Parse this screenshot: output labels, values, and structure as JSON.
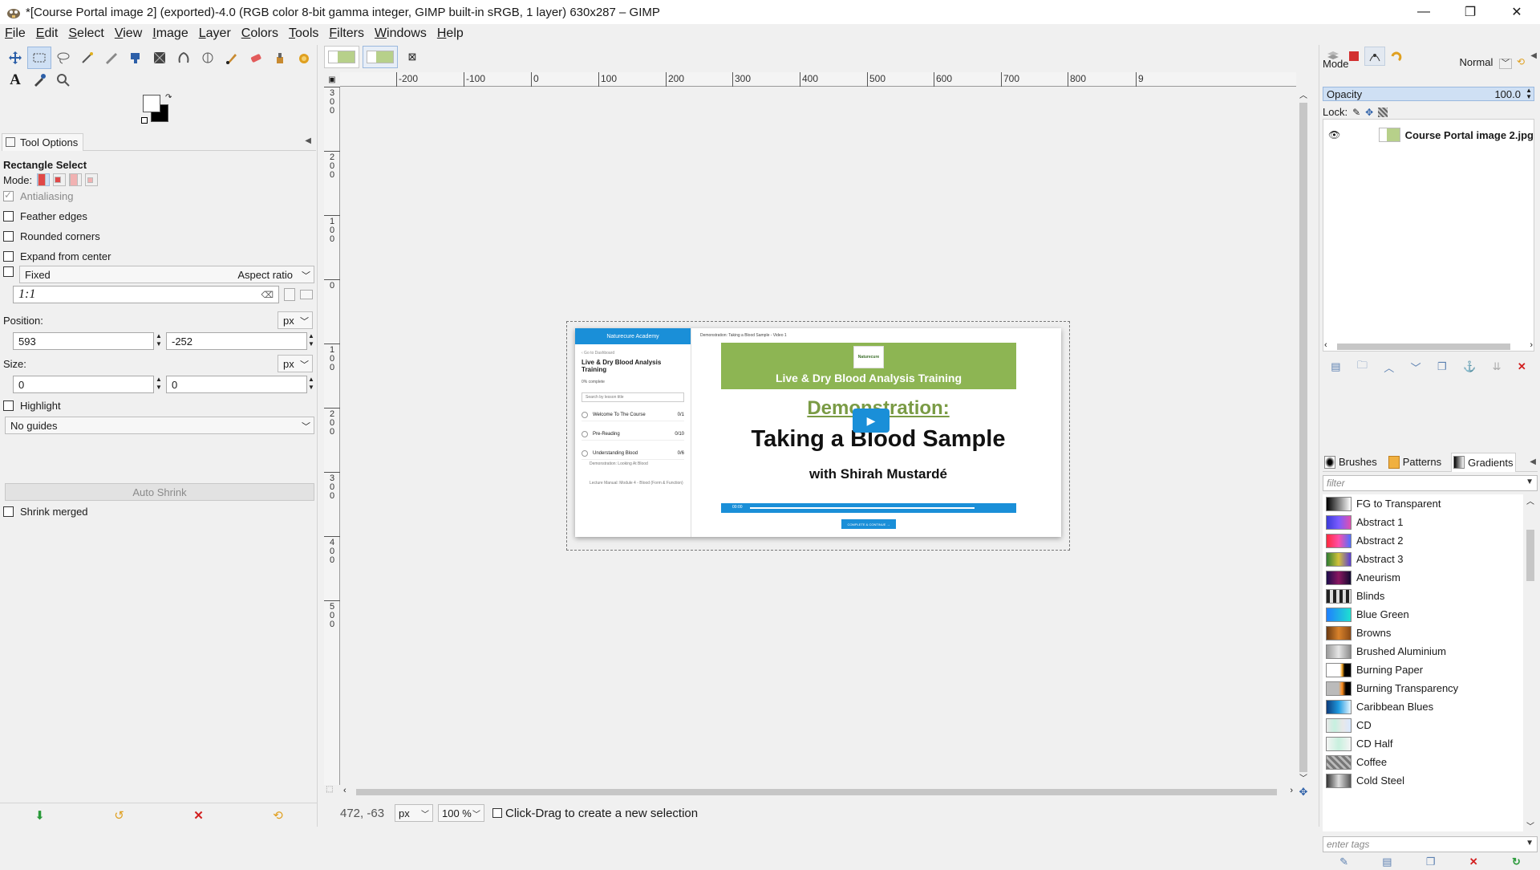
{
  "window": {
    "title": "*[Course Portal image 2] (exported)-4.0 (RGB color 8-bit gamma integer, GIMP built-in sRGB, 1 layer) 630x287 – GIMP",
    "minimize": "—",
    "maximize": "❐",
    "close": "✕"
  },
  "menu": [
    "File",
    "Edit",
    "Select",
    "View",
    "Image",
    "Layer",
    "Colors",
    "Tools",
    "Filters",
    "Windows",
    "Help"
  ],
  "toolbox": {
    "row1": [
      "move-tool-icon",
      "rect-select-icon",
      "lasso-icon",
      "fuzzy-select-icon",
      "paths-icon",
      "crop-icon",
      "transform-icon",
      "warp-icon",
      "perspective-icon",
      "paintbrush-icon",
      "eraser-icon",
      "clone-icon",
      "smudge-icon",
      "scissors-icon"
    ],
    "row2": [
      "text-tool-icon",
      "color-picker-icon",
      "zoom-icon"
    ]
  },
  "tool_options": {
    "tab_label": "Tool Options",
    "tool_name": "Rectangle Select",
    "mode_label": "Mode:",
    "antialiasing": "Antialiasing",
    "feather_edges": "Feather edges",
    "rounded_corners": "Rounded corners",
    "expand_from_center": "Expand from center",
    "fixed_label": "Fixed",
    "fixed_mode": "Aspect ratio",
    "ratio_value": "1:1",
    "position_label": "Position:",
    "position_unit": "px",
    "position_x": "593",
    "position_y": "-252",
    "size_label": "Size:",
    "size_unit": "px",
    "size_w": "0",
    "size_h": "0",
    "highlight": "Highlight",
    "guides": "No guides",
    "auto_shrink": "Auto Shrink",
    "shrink_merged": "Shrink merged"
  },
  "ruler": {
    "h_labels": [
      {
        "text": "-200",
        "pos": 0.0588
      },
      {
        "text": "-100",
        "pos": 0.1289
      },
      {
        "text": "0",
        "pos": 0.1999
      },
      {
        "text": "100",
        "pos": 0.2701
      },
      {
        "text": "200",
        "pos": 0.3402
      },
      {
        "text": "300",
        "pos": 0.4104
      },
      {
        "text": "400",
        "pos": 0.4808
      },
      {
        "text": "500",
        "pos": 0.5508
      },
      {
        "text": "600",
        "pos": 0.6207
      },
      {
        "text": "700",
        "pos": 0.691
      },
      {
        "text": "800",
        "pos": 0.7612
      },
      {
        "text": "9",
        "pos": 0.832
      }
    ],
    "v_labels": [
      {
        "text": "300",
        "pos": 0.0
      },
      {
        "text": "200",
        "pos": 0.092
      },
      {
        "text": "100",
        "pos": 0.184
      },
      {
        "text": "0",
        "pos": 0.276
      },
      {
        "text": "100",
        "pos": 0.368
      },
      {
        "text": "200",
        "pos": 0.46
      },
      {
        "text": "300",
        "pos": 0.552
      },
      {
        "text": "400",
        "pos": 0.644
      },
      {
        "text": "500",
        "pos": 0.736
      }
    ]
  },
  "canvas_image": {
    "brand": "Naturecure Academy",
    "back_link": "‹ Go to Dashboard",
    "course_title": "Live & Dry Blood Analysis Training",
    "progress": "0% complete",
    "search_placeholder": "Search by lesson title",
    "lessons": [
      {
        "title": "Welcome To The Course",
        "count": "0/1"
      },
      {
        "title": "Pre-Reading",
        "count": "0/10"
      },
      {
        "title": "Understanding Blood",
        "count": "0/6"
      }
    ],
    "sublessons": [
      "Demonstration: Looking At Blood",
      "Lecture Manual: Module 4 - Blood (Form & Function)"
    ],
    "video_header": "Demonstration: Taking a Blood Sample - Video 1",
    "logo_text": "Naturecure",
    "banner_text": "Live & Dry Blood Analysis Training",
    "demo_heading": "Demonstration:",
    "main_title": "Taking a Blood Sample",
    "subtitle": "with Shirah Mustardé",
    "video_time": "00:00",
    "cta": "COMPLETE & CONTINUE →"
  },
  "status": {
    "coords": "472, -63",
    "unit": "px",
    "zoom": "100 %",
    "message": "Click-Drag to create a new selection"
  },
  "layers_panel": {
    "mode_label": "Mode",
    "mode_value": "Normal",
    "opacity_label": "Opacity",
    "opacity_value": "100.0",
    "lock_label": "Lock:",
    "layer_name": "Course Portal image 2.jpg"
  },
  "resources": {
    "tabs": [
      "Brushes",
      "Patterns",
      "Gradients"
    ],
    "filter_placeholder": "filter",
    "tags_placeholder": "enter tags",
    "gradients": [
      {
        "name": "FG to Transparent",
        "css": "linear-gradient(90deg,#000,rgba(0,0,0,0))"
      },
      {
        "name": "Abstract 1",
        "css": "linear-gradient(90deg,#3b3bd8,#7a5cff,#e04fb0)"
      },
      {
        "name": "Abstract 2",
        "css": "linear-gradient(90deg,#ff2a3d,#ff4fa8,#4f6fff)"
      },
      {
        "name": "Abstract 3",
        "css": "linear-gradient(90deg,#2e7d32,#d4c23a,#5a3bd8)"
      },
      {
        "name": "Aneurism",
        "css": "linear-gradient(90deg,#1b0c4a,#8a1660,#120a30)"
      },
      {
        "name": "Blinds",
        "css": "repeating-linear-gradient(90deg,#222 0 4px,#ddd 4px 8px)"
      },
      {
        "name": "Blue Green",
        "css": "linear-gradient(90deg,#1f7fff,#1fe0d0)"
      },
      {
        "name": "Browns",
        "css": "linear-gradient(90deg,#6b3a12,#d9822b,#8a4a16)"
      },
      {
        "name": "Brushed Aluminium",
        "css": "linear-gradient(90deg,#9a9a9a,#e6e6e6,#8a8a8a)"
      },
      {
        "name": "Burning Paper",
        "css": "linear-gradient(90deg,#fff 55%,#f1a21f 65%,#000 75%)"
      },
      {
        "name": "Burning Transparency",
        "css": "linear-gradient(90deg,#bbb 50%,#ff8c1a 65%,#000 80%)"
      },
      {
        "name": "Caribbean Blues",
        "css": "linear-gradient(90deg,#0c3a7a,#1f9be0,#e8f6ff)"
      },
      {
        "name": "CD",
        "css": "linear-gradient(90deg,#e8e8e8,#c6f0e0,#e8e8e8,#d8e8ff)"
      },
      {
        "name": "CD Half",
        "css": "linear-gradient(90deg,#f4f4f4,#c8f0de,#f4f4f4)"
      },
      {
        "name": "Coffee",
        "css": "repeating-linear-gradient(45deg,#777 0 3px,#bbb 3px 6px)"
      },
      {
        "name": "Cold Steel",
        "css": "linear-gradient(90deg,#333,#ddd,#555)"
      }
    ]
  },
  "colors": {
    "accent": "#1a8fd8",
    "banner_green": "#8db553",
    "demo_green": "#7a9b45",
    "selection_blue": "#cfe0f4"
  }
}
